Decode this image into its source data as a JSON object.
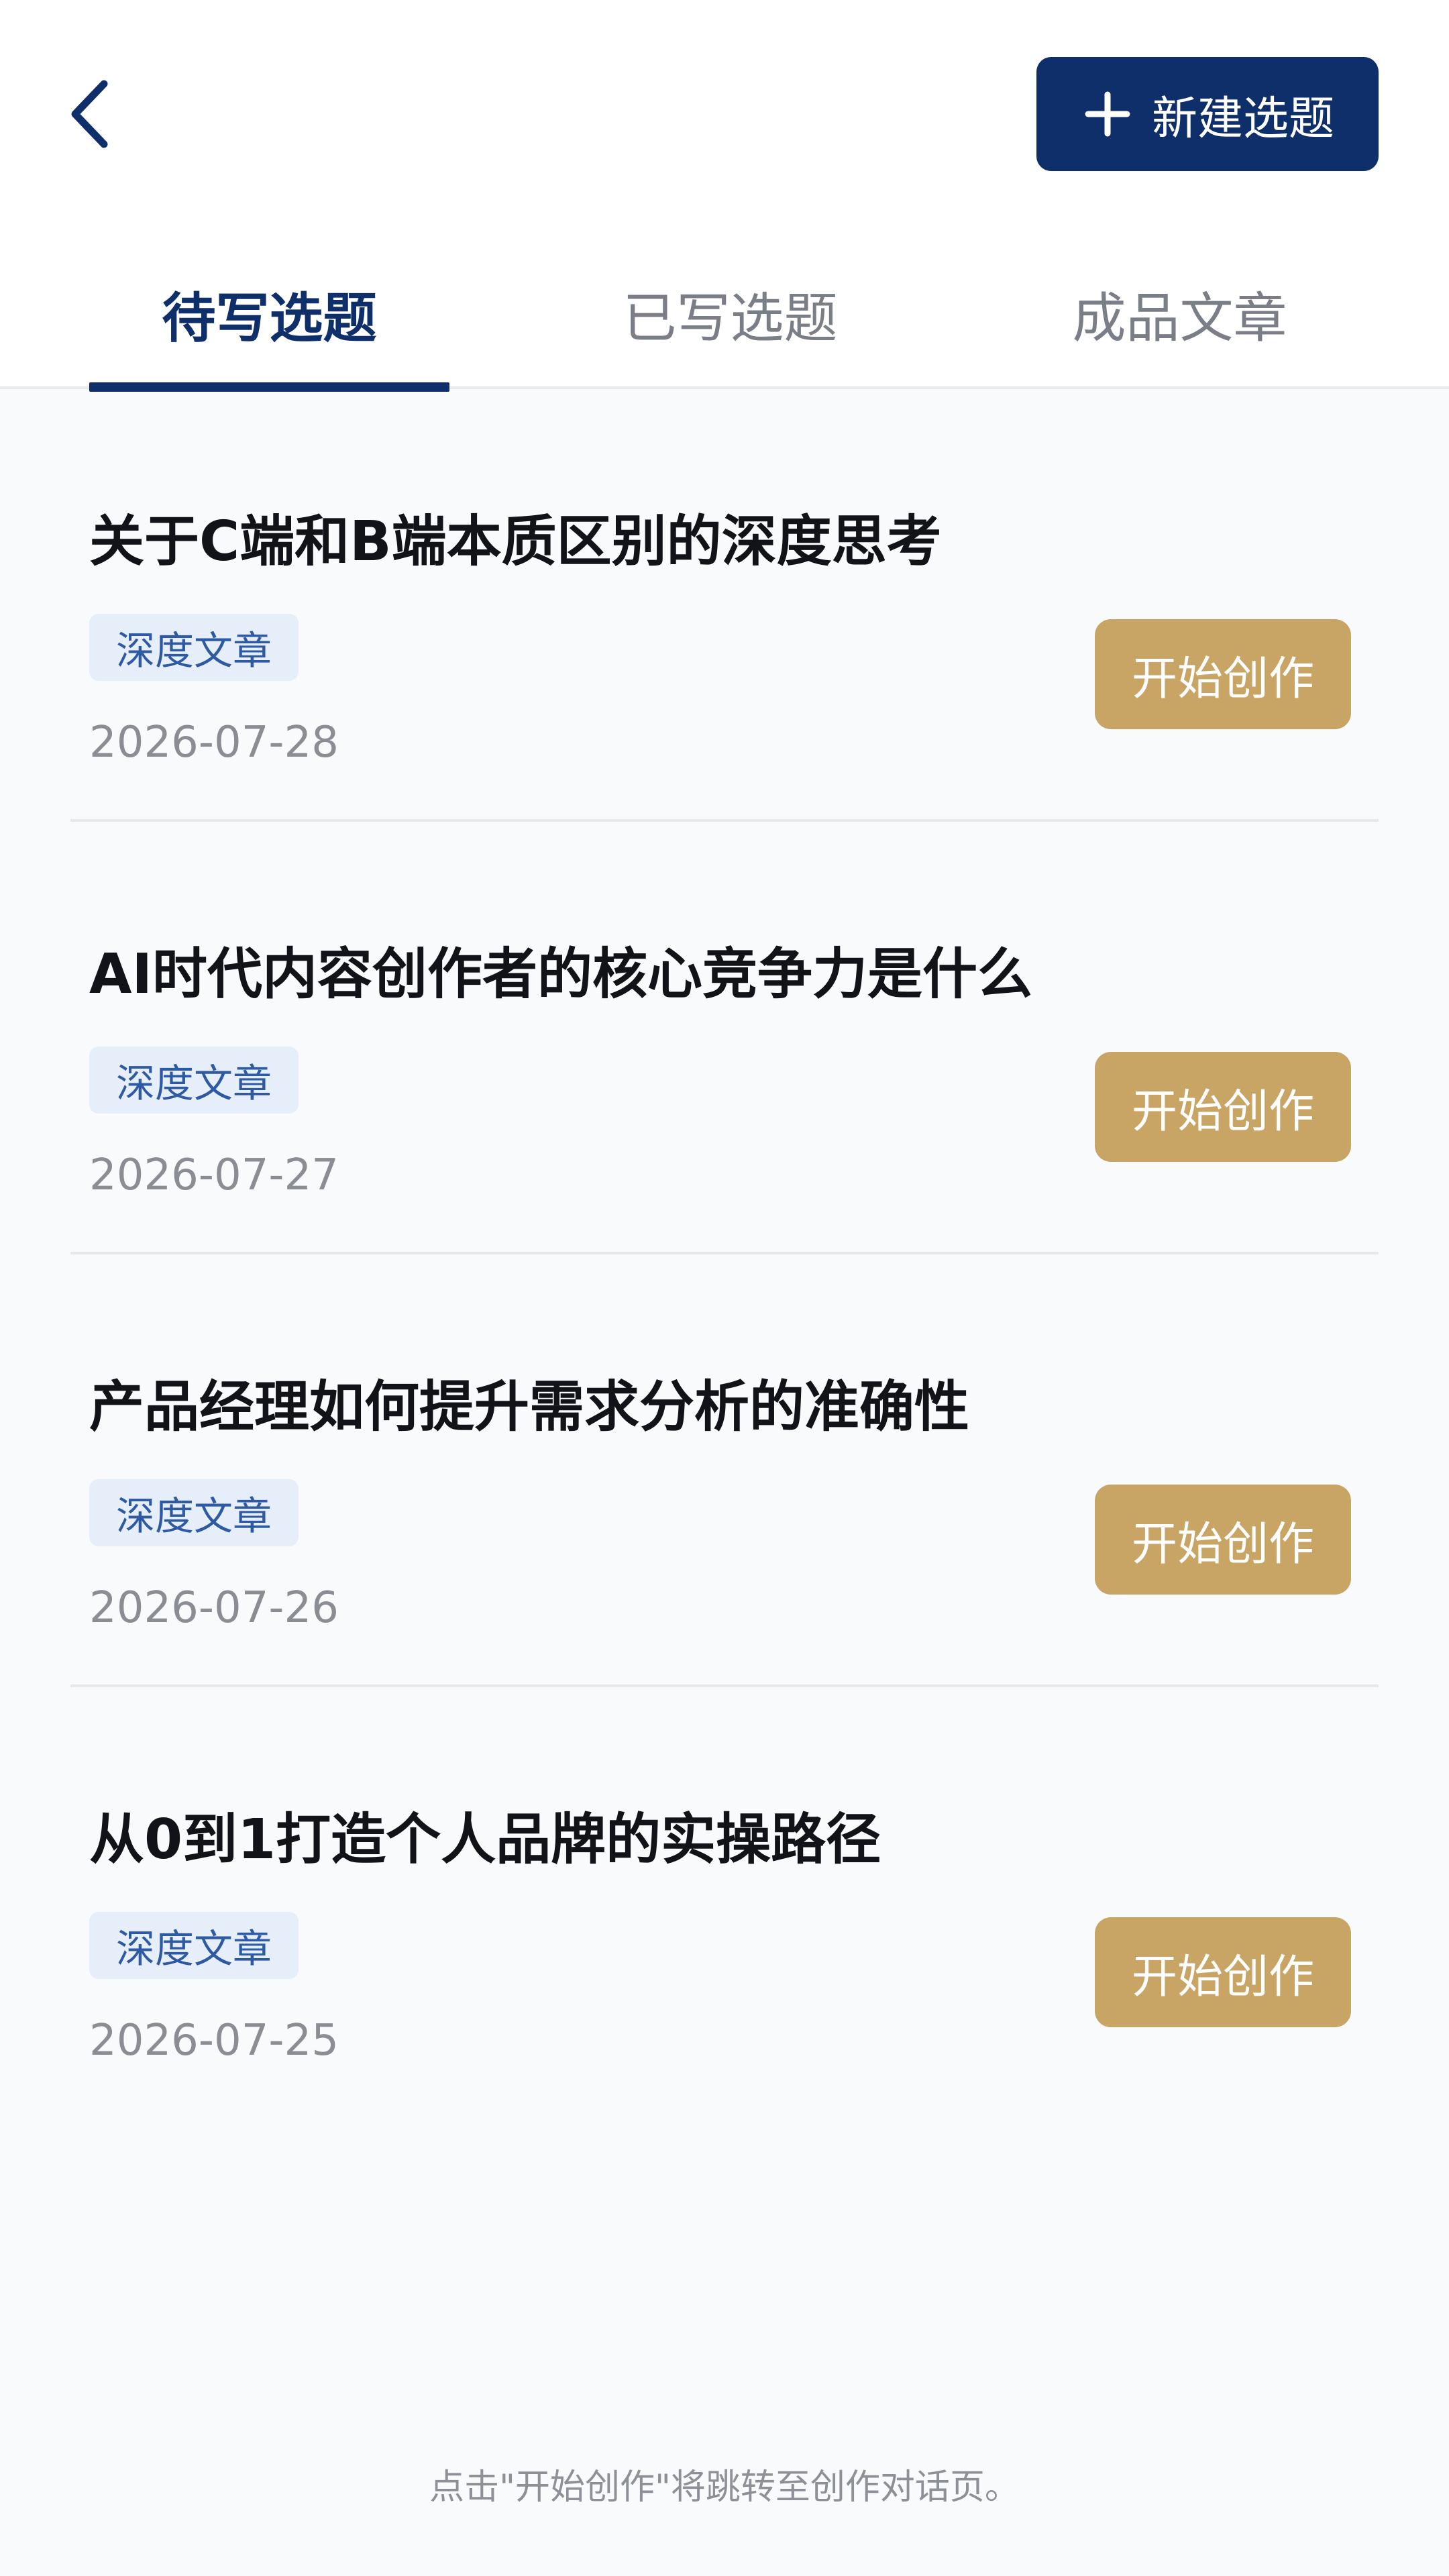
{
  "header": {
    "new_topic_label": "新建选题"
  },
  "tabs": [
    {
      "label": "待写选题",
      "active": true
    },
    {
      "label": "已写选题",
      "active": false
    },
    {
      "label": "成品文章",
      "active": false
    }
  ],
  "items": [
    {
      "title": "关于C端和B端本质区别的深度思考",
      "tag": "深度文章",
      "date": "2026-07-28",
      "action": "开始创作"
    },
    {
      "title": "AI时代内容创作者的核心竞争力是什么",
      "tag": "深度文章",
      "date": "2026-07-27",
      "action": "开始创作"
    },
    {
      "title": "产品经理如何提升需求分析的准确性",
      "tag": "深度文章",
      "date": "2026-07-26",
      "action": "开始创作"
    },
    {
      "title": "从0到1打造个人品牌的实操路径",
      "tag": "深度文章",
      "date": "2026-07-25",
      "action": "开始创作"
    }
  ],
  "footer": {
    "hint": "点击\"开始创作\"将跳转至创作对话页。"
  },
  "icons": {
    "back": "chevron-left-icon",
    "add": "plus-icon"
  },
  "colors": {
    "primary": "#0f2f6b",
    "accent": "#c8a565",
    "tag_bg": "#e6eefa",
    "tag_text": "#2e5aa3"
  }
}
